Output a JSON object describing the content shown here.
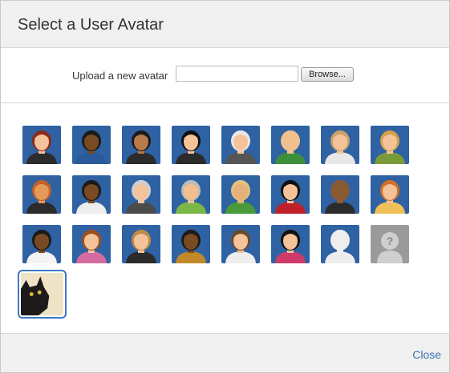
{
  "dialog": {
    "title": "Select a User Avatar",
    "upload_label": "Upload a new avatar",
    "file_input_value": "",
    "browse_label": "Browse...",
    "close_label": "Close"
  },
  "colors": {
    "tile_blue": "#2f62a3",
    "tile_gray": "#9a9a9a",
    "link_blue": "#3b73af",
    "selection": "#3c79c6"
  },
  "avatars": [
    {
      "name": "avatar-woman-red-hair-glasses",
      "skin": "#f4c39a",
      "hair": "#8b2a1a",
      "shirt": "#2b2b2b",
      "bg": "#2f62a3"
    },
    {
      "name": "avatar-woman-dark-skin",
      "skin": "#7a4a22",
      "hair": "#1a1a1a",
      "shirt": "#2a5a9a",
      "bg": "#2f62a3"
    },
    {
      "name": "avatar-man-beard",
      "skin": "#b87a4b",
      "hair": "#1a1a1a",
      "shirt": "#2b2b2b",
      "bg": "#2f62a3"
    },
    {
      "name": "avatar-woman-black-hair",
      "skin": "#f4c39a",
      "hair": "#111111",
      "shirt": "#2b2b2b",
      "bg": "#2f62a3"
    },
    {
      "name": "avatar-old-man-white-hair",
      "skin": "#f4c39a",
      "hair": "#e8e8e8",
      "shirt": "#555555",
      "bg": "#2f62a3"
    },
    {
      "name": "avatar-bald-man-green-shirt",
      "skin": "#f2c08e",
      "hair": "#f2c08e",
      "shirt": "#3c8f3c",
      "bg": "#2f62a3"
    },
    {
      "name": "avatar-woman-blonde-headband",
      "skin": "#f4c39a",
      "hair": "#c9a26a",
      "shirt": "#e8e8e8",
      "bg": "#2f62a3"
    },
    {
      "name": "avatar-woman-blonde-ponytail",
      "skin": "#f4c39a",
      "hair": "#d1a14a",
      "shirt": "#7a9a3a",
      "bg": "#2f62a3"
    },
    {
      "name": "avatar-man-orange-hair",
      "skin": "#e69a5a",
      "hair": "#c0602a",
      "shirt": "#2b2b2b",
      "bg": "#2f62a3"
    },
    {
      "name": "avatar-man-dark-skin-white-shirt",
      "skin": "#7a4a22",
      "hair": "#1a1a1a",
      "shirt": "#eeeeee",
      "bg": "#2f62a3"
    },
    {
      "name": "avatar-old-man-mustache",
      "skin": "#f4c39a",
      "hair": "#cfcfcf",
      "shirt": "#4a4a4a",
      "bg": "#2f62a3"
    },
    {
      "name": "avatar-man-sunglasses",
      "skin": "#f2c08e",
      "hair": "#bbbbbb",
      "shirt": "#7ab648",
      "bg": "#2f62a3"
    },
    {
      "name": "avatar-man-hat-striped-shirt",
      "skin": "#e6b07a",
      "hair": "#e0c27a",
      "shirt": "#4a9a3a",
      "bg": "#2f62a3"
    },
    {
      "name": "avatar-woman-red-shirt",
      "skin": "#f4c39a",
      "hair": "#111111",
      "shirt": "#c0202a",
      "bg": "#2f62a3"
    },
    {
      "name": "avatar-bald-man-glasses",
      "skin": "#8a5a32",
      "hair": "#8a5a32",
      "shirt": "#2b2b2b",
      "bg": "#2f62a3"
    },
    {
      "name": "avatar-man-ginger",
      "skin": "#f4c39a",
      "hair": "#d0702a",
      "shirt": "#f0c05a",
      "bg": "#2f62a3"
    },
    {
      "name": "avatar-man-dark-skin-tie",
      "skin": "#7a4a22",
      "hair": "#1a1a1a",
      "shirt": "#f3f3f3",
      "bg": "#2f62a3"
    },
    {
      "name": "avatar-woman-auburn-hair",
      "skin": "#f4c39a",
      "hair": "#a0501f",
      "shirt": "#d46aa0",
      "bg": "#2f62a3"
    },
    {
      "name": "avatar-man-suit",
      "skin": "#f4c39a",
      "hair": "#c08a4a",
      "shirt": "#2b2b2b",
      "bg": "#2f62a3"
    },
    {
      "name": "avatar-woman-afro",
      "skin": "#7a4a22",
      "hair": "#1a1a1a",
      "shirt": "#c08a2a",
      "bg": "#2f62a3"
    },
    {
      "name": "avatar-man-glasses-gray-shirt",
      "skin": "#f4c39a",
      "hair": "#6a4a2a",
      "shirt": "#eeeeee",
      "bg": "#2f62a3"
    },
    {
      "name": "avatar-woman-striped-shirt",
      "skin": "#f4c39a",
      "hair": "#111111",
      "shirt": "#d03a6a",
      "bg": "#2f62a3"
    },
    {
      "name": "avatar-silhouette-default",
      "skin": "#eeeeee",
      "hair": "#eeeeee",
      "shirt": "#eeeeee",
      "bg": "#2f62a3"
    },
    {
      "name": "avatar-unknown-question-mark",
      "skin": "#cfcfcf",
      "hair": "#cfcfcf",
      "shirt": "#cfcfcf",
      "bg": "#9a9a9a"
    },
    {
      "name": "avatar-custom-cat-photo",
      "skin": "#222222",
      "hair": "#222222",
      "shirt": "#222222",
      "bg": "#efe3c5",
      "selected": true
    }
  ]
}
